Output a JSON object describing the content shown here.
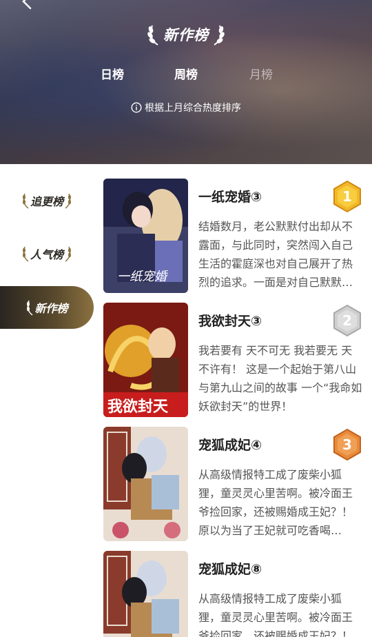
{
  "header": {
    "title": "新作榜",
    "tabs": [
      {
        "label": "日榜",
        "active": false
      },
      {
        "label": "周榜",
        "active": false
      },
      {
        "label": "月榜",
        "active": true
      }
    ],
    "hint": "根据上月综合热度排序"
  },
  "sidebar": {
    "items": [
      {
        "label": "追更榜",
        "active": false
      },
      {
        "label": "人气榜",
        "active": false
      },
      {
        "label": "新作榜",
        "active": true
      }
    ]
  },
  "list": [
    {
      "title": "一纸宠婚③",
      "rank": "1",
      "desc": "结婚数月，老公默默付出却从不露面，与此同时，突然闯入自己生活的霍庭深也对自己展开了热烈的追求。一面是对自己默默付出的老公，一面是热烈追求自己的霍庭深……"
    },
    {
      "title": "我欲封天③",
      "rank": "2",
      "desc": "我若要有 天不可无 我若要无 天不许有！ 这是一个起始于第八山与第九山之间的故事 一个“我命如妖欲封天”的世界！"
    },
    {
      "title": "宠狐成妃④",
      "rank": "3",
      "desc": "从高级情报特工成了废柴小狐狸，童灵灵心里苦啊。被冷面王爷捡回家，还被赐婚成王妃？！ 原以为当了王妃就可吃香喝辣……"
    },
    {
      "title": "宠狐成妃⑧",
      "rank": "",
      "desc": "从高级情报特工成了废柴小狐狸，童灵灵心里苦啊。被冷面王爷捡回家，还被赐婚成王妃？！ 原以为当了王妃就可吃香喝辣……"
    }
  ],
  "colors": {
    "gold": "#e8a21a",
    "silver": "#b9b9b9",
    "bronze": "#e07a2a",
    "sidebar_active": "#5a4a2d"
  }
}
